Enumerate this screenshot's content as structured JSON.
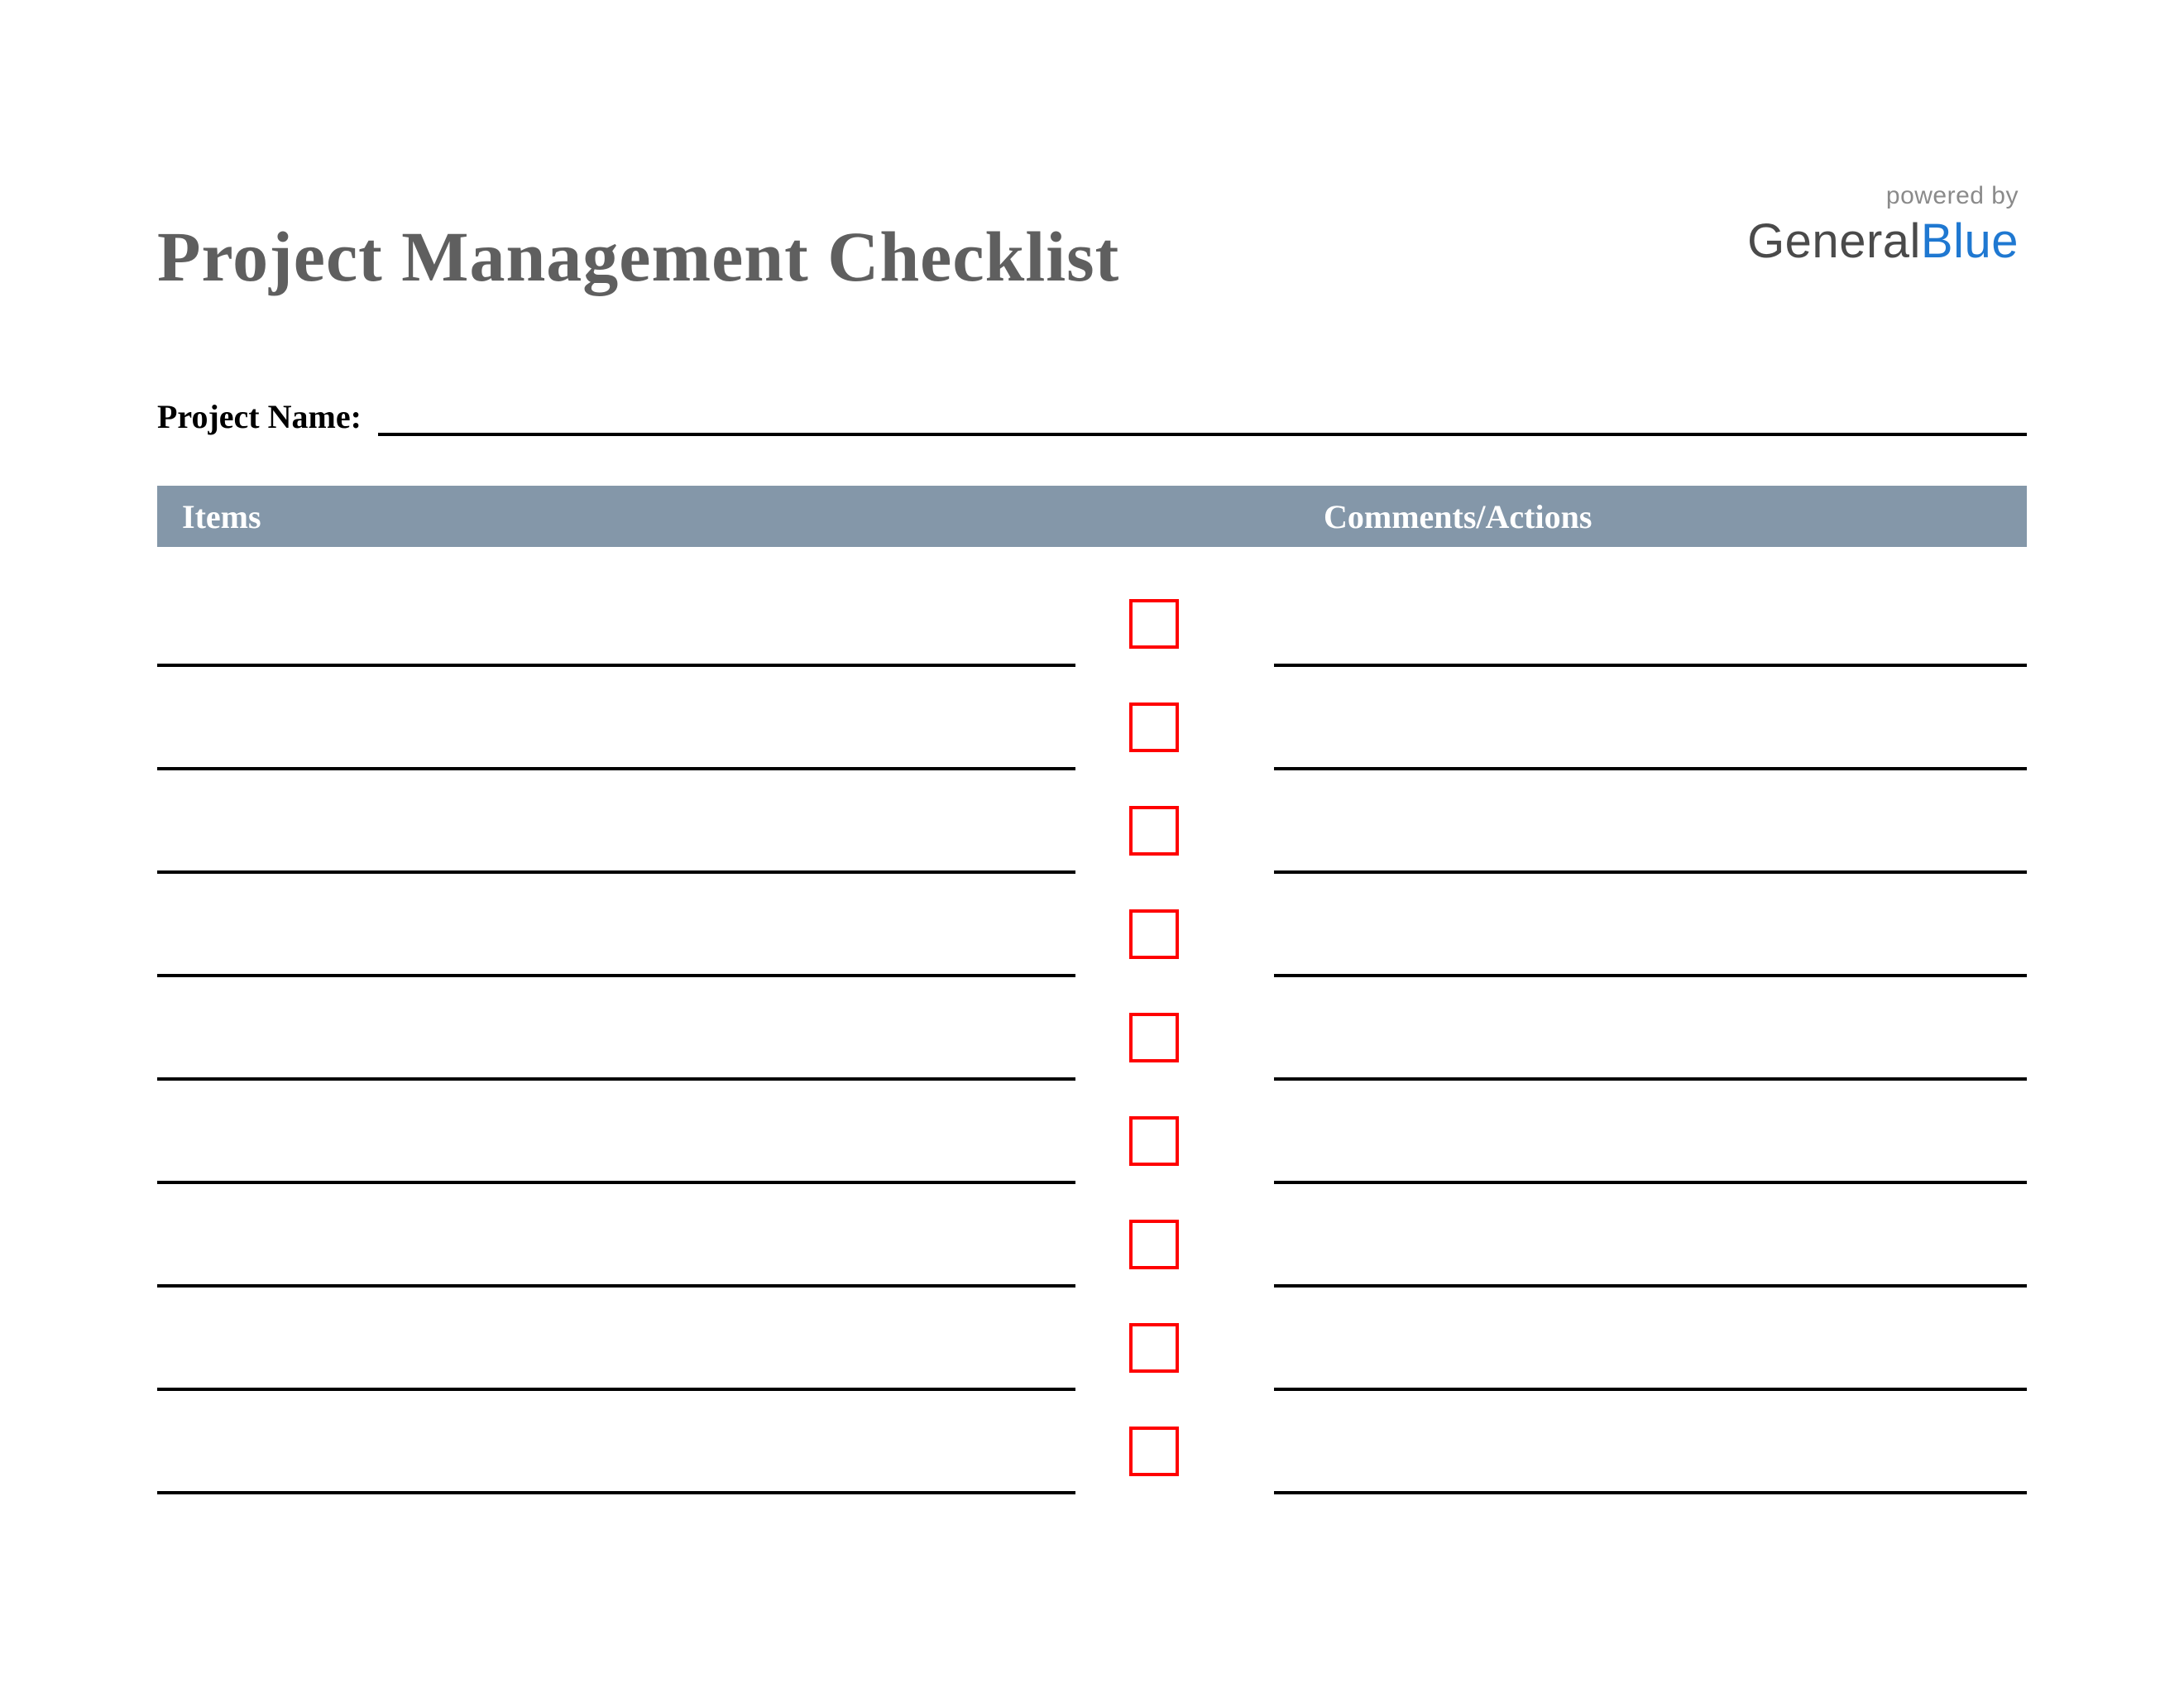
{
  "title": "Project Management Checklist",
  "brand": {
    "powered_by": "powered by",
    "name_part1": "General",
    "name_part2": "Blue"
  },
  "project_name_label": "Project Name:",
  "project_name_value": "",
  "table": {
    "header_items": "Items",
    "header_comments": "Comments/Actions"
  },
  "rows": [
    {
      "item": "",
      "checked": false,
      "comment": ""
    },
    {
      "item": "",
      "checked": false,
      "comment": ""
    },
    {
      "item": "",
      "checked": false,
      "comment": ""
    },
    {
      "item": "",
      "checked": false,
      "comment": ""
    },
    {
      "item": "",
      "checked": false,
      "comment": ""
    },
    {
      "item": "",
      "checked": false,
      "comment": ""
    },
    {
      "item": "",
      "checked": false,
      "comment": ""
    },
    {
      "item": "",
      "checked": false,
      "comment": ""
    },
    {
      "item": "",
      "checked": false,
      "comment": ""
    }
  ],
  "colors": {
    "header_band": "#8497a9",
    "checkbox_border": "#ff0000",
    "brand_blue": "#1f78d1",
    "title_gray": "#5f5f5f"
  }
}
